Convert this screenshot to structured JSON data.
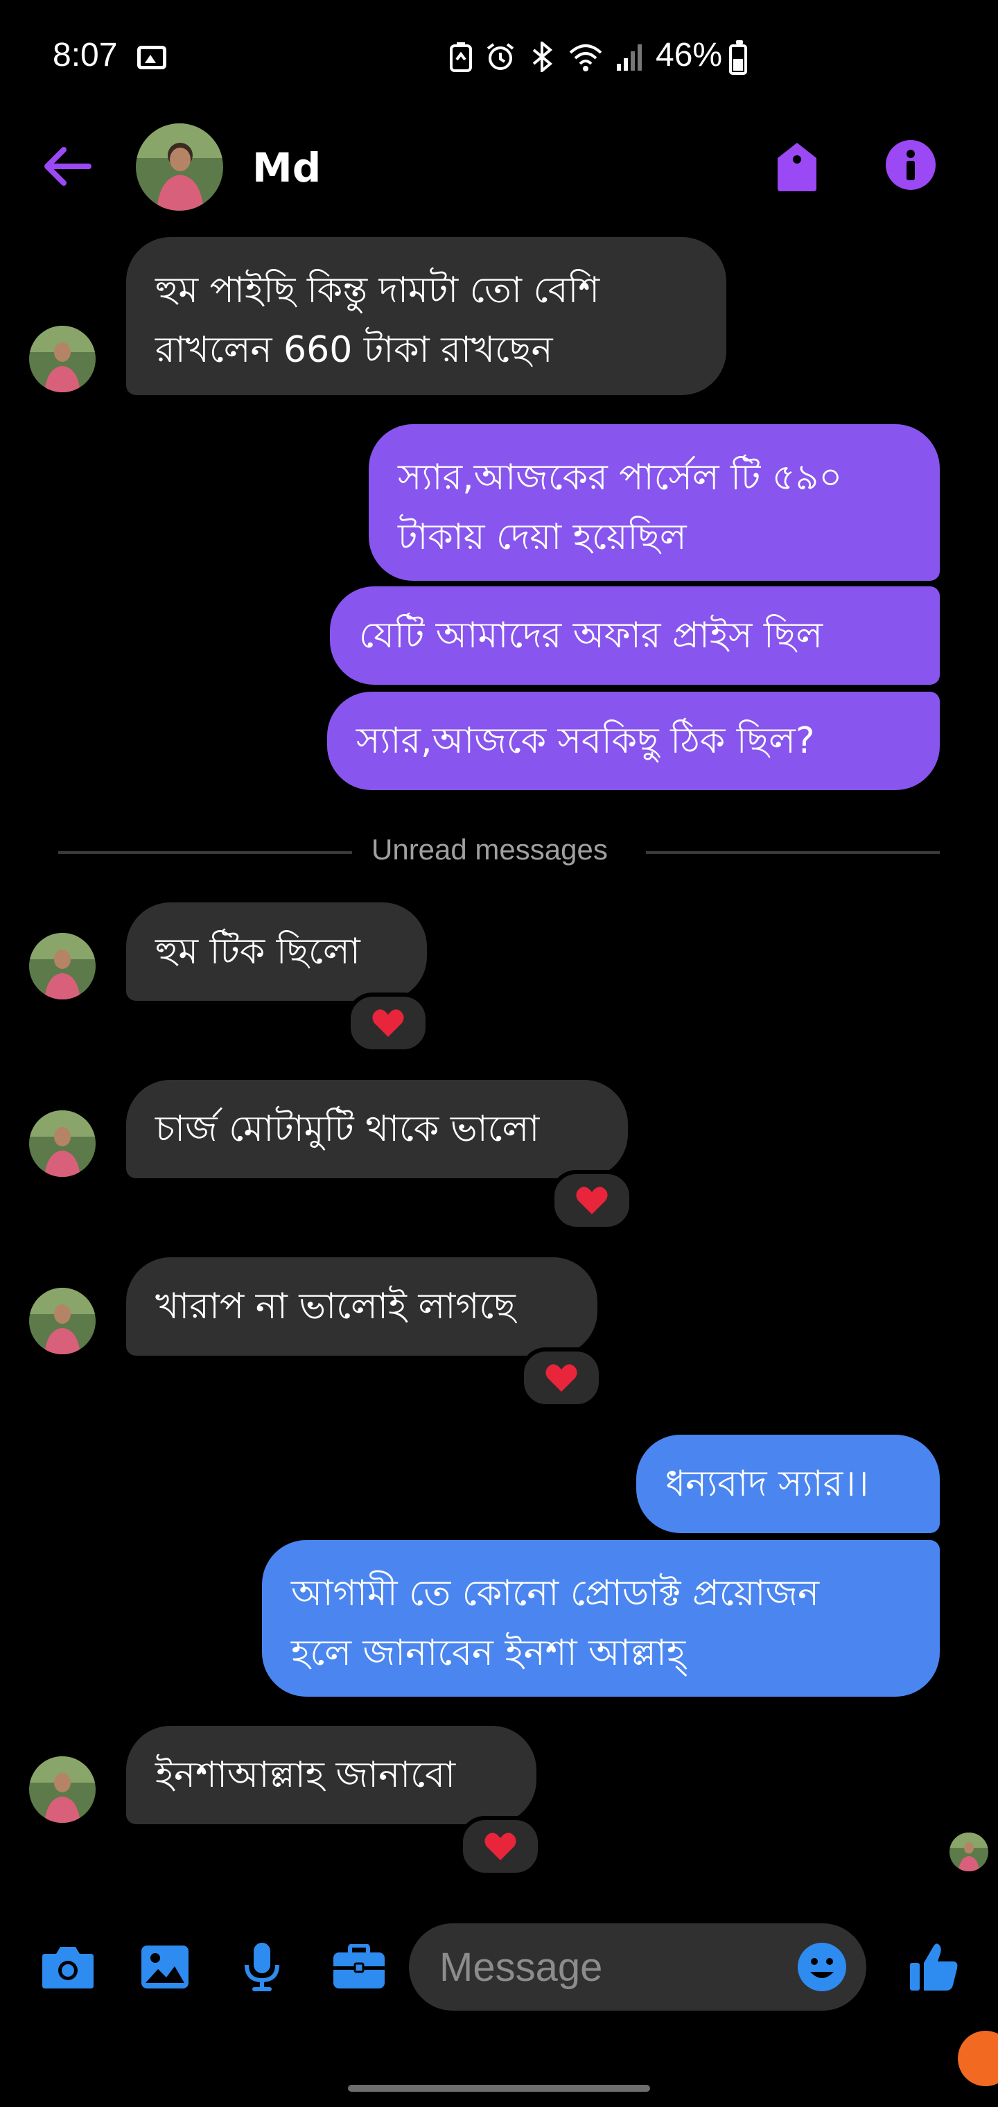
{
  "status_bar": {
    "time": "8:07",
    "battery": "46%",
    "battery_level": 0.46,
    "icons": [
      "gallery-icon",
      "battery-saver-icon",
      "alarm-icon",
      "bluetooth-icon",
      "wifi-icon",
      "signal-icon"
    ]
  },
  "header": {
    "name": "Md",
    "back_icon": "arrow-left-icon",
    "tag_icon": "tag-icon",
    "info_icon": "info-icon"
  },
  "messages": [
    {
      "direction": "in",
      "text": "হুম পাইছি কিন্তু দামটা তো বেশি\nরাখলেন 660 টাকা রাখছেন"
    },
    {
      "direction": "out",
      "text": "স্যার,আজকের পার্সেল টি ৫৯০\nটাকায় দেয়া হয়েছিল"
    },
    {
      "direction": "out",
      "text": "যেটি আমাদের অফার প্রাইস ছিল"
    },
    {
      "direction": "out",
      "text": "স্যার,আজকে সবকিছু ঠিক ছিল?"
    },
    {
      "direction": "in",
      "text": "হুম টিক ছিলো",
      "reaction": "❤️"
    },
    {
      "direction": "in",
      "text": "চার্জ মোটামুটি থাকে ভালো",
      "reaction": "❤️"
    },
    {
      "direction": "in",
      "text": "খারাপ না ভালোই লাগছে",
      "reaction": "❤️"
    },
    {
      "direction": "out",
      "text": "ধন্যবাদ স্যার।।"
    },
    {
      "direction": "out",
      "text": "আগামী তে কোনো প্রোডাক্ট প্রয়োজন\nহলে জানাবেন ইনশা আল্লাহ্"
    },
    {
      "direction": "in",
      "text": "ইনশাআল্লাহ জানাবো",
      "reaction": "❤️"
    }
  ],
  "divider": {
    "label": "Unread messages"
  },
  "composer": {
    "placeholder": "Message",
    "icons": [
      "camera-icon",
      "image-icon",
      "microphone-icon",
      "briefcase-icon",
      "emoji-icon",
      "thumbs-up-icon"
    ]
  },
  "colors": {
    "accent": "#9b48f5",
    "outgoing_purple": "#8856ee",
    "outgoing_blue": "#4b86f0",
    "incoming": "#303030",
    "composer_icon": "#2e8bf0"
  }
}
